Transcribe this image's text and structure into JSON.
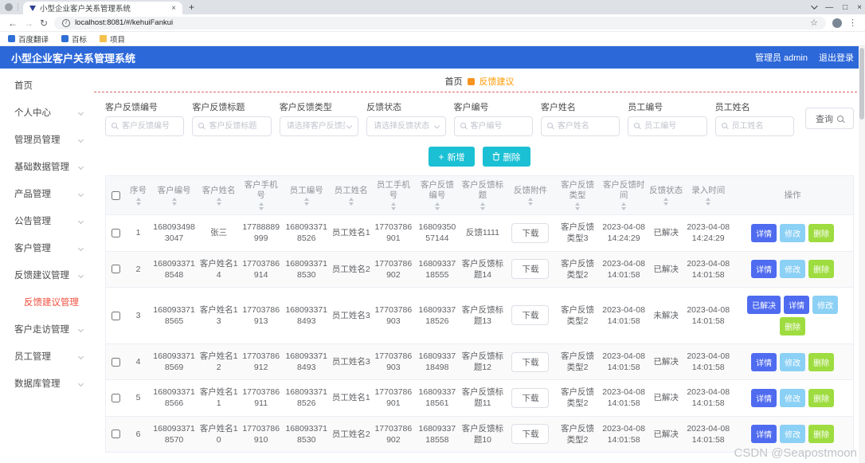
{
  "browser": {
    "tab_title": "小型企业客户关系管理系统",
    "url": "localhost:8081/#/kehuiFankui",
    "bookmarks": [
      "百度翻译",
      "百标",
      "项目"
    ]
  },
  "header": {
    "title": "小型企业客户关系管理系统",
    "user": "管理员 admin",
    "logout": "退出登录"
  },
  "sidebar": [
    {
      "label": "首页",
      "arrow": false,
      "sub": false,
      "active": false
    },
    {
      "label": "个人中心",
      "arrow": true,
      "sub": false,
      "active": false
    },
    {
      "label": "管理员管理",
      "arrow": true,
      "sub": false,
      "active": false
    },
    {
      "label": "基础数据管理",
      "arrow": true,
      "sub": false,
      "active": false
    },
    {
      "label": "产品管理",
      "arrow": true,
      "sub": false,
      "active": false
    },
    {
      "label": "公告管理",
      "arrow": true,
      "sub": false,
      "active": false
    },
    {
      "label": "客户管理",
      "arrow": true,
      "sub": false,
      "active": false
    },
    {
      "label": "反馈建议管理",
      "arrow": true,
      "sub": false,
      "active": false
    },
    {
      "label": "反馈建议管理",
      "arrow": false,
      "sub": true,
      "active": true
    },
    {
      "label": "客户走访管理",
      "arrow": true,
      "sub": false,
      "active": false
    },
    {
      "label": "员工管理",
      "arrow": true,
      "sub": false,
      "active": false
    },
    {
      "label": "数据库管理",
      "arrow": true,
      "sub": false,
      "active": false
    }
  ],
  "breadcrumb": {
    "home": "首页",
    "current": "反馈建议"
  },
  "search": {
    "fields": [
      {
        "label": "客户反馈编号",
        "placeholder": "客户反馈编号",
        "type": "input"
      },
      {
        "label": "客户反馈标题",
        "placeholder": "客户反馈标题",
        "type": "input"
      },
      {
        "label": "客户反馈类型",
        "placeholder": "请选择客户反馈类型",
        "type": "select"
      },
      {
        "label": "反馈状态",
        "placeholder": "请选择反馈状态",
        "type": "select"
      },
      {
        "label": "客户编号",
        "placeholder": "客户编号",
        "type": "input"
      },
      {
        "label": "客户姓名",
        "placeholder": "客户姓名",
        "type": "input"
      },
      {
        "label": "员工编号",
        "placeholder": "员工编号",
        "type": "input"
      },
      {
        "label": "员工姓名",
        "placeholder": "员工姓名",
        "type": "input"
      }
    ],
    "query_label": "查询"
  },
  "toolbar": {
    "add_label": "新增",
    "delete_label": "删除"
  },
  "table": {
    "headers": [
      "",
      "序号",
      "客户编号",
      "客户姓名",
      "客户手机号",
      "员工编号",
      "员工姓名",
      "员工手机号",
      "客户反馈编号",
      "客户反馈标题",
      "反馈附件",
      "客户反馈类型",
      "客户反馈时间",
      "反馈状态",
      "录入时间",
      "操作"
    ],
    "sortable": [
      false,
      true,
      true,
      true,
      true,
      true,
      true,
      true,
      true,
      true,
      true,
      true,
      true,
      true,
      true,
      false
    ],
    "download_label": "下载",
    "action_labels": {
      "resolve": "已解决",
      "detail": "详情",
      "edit": "修改",
      "delete": "删除"
    },
    "rows": [
      {
        "index": 1,
        "customer_id": "1680934983047",
        "customer_name": "张三",
        "customer_phone": "17788889999",
        "employee_id": "1680933718526",
        "employee_name": "员工姓名1",
        "employee_phone": "17703786901",
        "feedback_id": "1680935057144",
        "feedback_title": "反馈1111",
        "feedback_type": "客户反馈类型3",
        "feedback_time": "2023-04-08 14:24:29",
        "status": "已解决",
        "entry_time": "2023-04-08 14:24:29",
        "show_resolve": false
      },
      {
        "index": 2,
        "customer_id": "1680933718548",
        "customer_name": "客户姓名14",
        "customer_phone": "17703786914",
        "employee_id": "1680933718530",
        "employee_name": "员工姓名2",
        "employee_phone": "17703786902",
        "feedback_id": "1680933718555",
        "feedback_title": "客户反馈标题14",
        "feedback_type": "客户反馈类型2",
        "feedback_time": "2023-04-08 14:01:58",
        "status": "已解决",
        "entry_time": "2023-04-08 14:01:58",
        "show_resolve": false
      },
      {
        "index": 3,
        "customer_id": "1680933718565",
        "customer_name": "客户姓名13",
        "customer_phone": "17703786913",
        "employee_id": "1680933718493",
        "employee_name": "员工姓名3",
        "employee_phone": "17703786903",
        "feedback_id": "1680933718526",
        "feedback_title": "客户反馈标题13",
        "feedback_type": "客户反馈类型2",
        "feedback_time": "2023-04-08 14:01:58",
        "status": "未解决",
        "entry_time": "2023-04-08 14:01:58",
        "show_resolve": true
      },
      {
        "index": 4,
        "customer_id": "1680933718569",
        "customer_name": "客户姓名12",
        "customer_phone": "17703786912",
        "employee_id": "1680933718493",
        "employee_name": "员工姓名3",
        "employee_phone": "17703786903",
        "feedback_id": "1680933718498",
        "feedback_title": "客户反馈标题12",
        "feedback_type": "客户反馈类型2",
        "feedback_time": "2023-04-08 14:01:58",
        "status": "已解决",
        "entry_time": "2023-04-08 14:01:58",
        "show_resolve": false
      },
      {
        "index": 5,
        "customer_id": "1680933718566",
        "customer_name": "客户姓名11",
        "customer_phone": "17703786911",
        "employee_id": "1680933718526",
        "employee_name": "员工姓名1",
        "employee_phone": "17703786901",
        "feedback_id": "1680933718561",
        "feedback_title": "客户反馈标题11",
        "feedback_type": "客户反馈类型2",
        "feedback_time": "2023-04-08 14:01:58",
        "status": "已解决",
        "entry_time": "2023-04-08 14:01:58",
        "show_resolve": false
      },
      {
        "index": 6,
        "customer_id": "1680933718570",
        "customer_name": "客户姓名10",
        "customer_phone": "17703786910",
        "employee_id": "1680933718530",
        "employee_name": "员工姓名2",
        "employee_phone": "17703786902",
        "feedback_id": "1680933718558",
        "feedback_title": "客户反馈标题10",
        "feedback_type": "客户反馈类型2",
        "feedback_time": "2023-04-08 14:01:58",
        "status": "已解决",
        "entry_time": "2023-04-08 14:01:58",
        "show_resolve": false
      }
    ]
  },
  "watermark": "CSDN @Seapostmoon"
}
